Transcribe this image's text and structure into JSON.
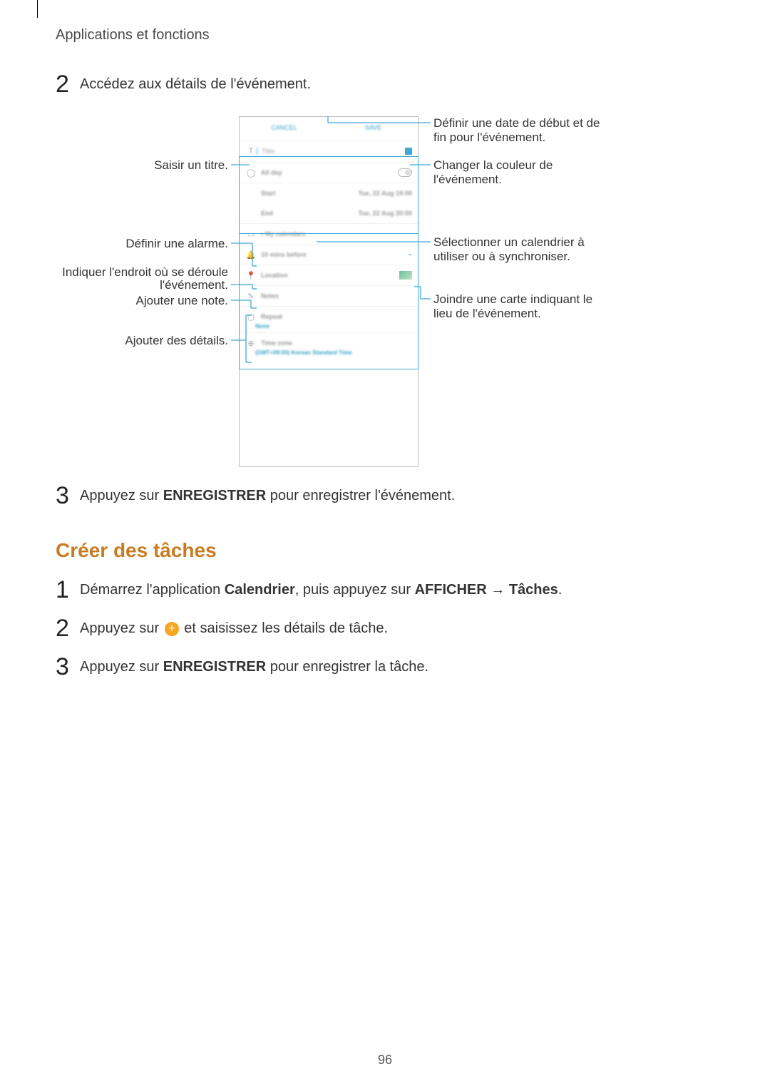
{
  "header": {
    "title": "Applications et fonctions"
  },
  "sec1": {
    "step2": {
      "num": "2",
      "text": "Accédez aux détails de l'événement."
    },
    "step3": {
      "num": "3",
      "prefix": "Appuyez sur ",
      "bold": "ENREGISTRER",
      "suffix": " pour enregistrer l'événement."
    }
  },
  "callouts": {
    "left": {
      "title": "Saisir un titre.",
      "alarm": "Définir une alarme.",
      "location_l1": "Indiquer l'endroit où se déroule",
      "location_l2": "l'événement.",
      "note": "Ajouter une note.",
      "details": "Ajouter des détails."
    },
    "right": {
      "dates_l1": "Définir une date de début et de",
      "dates_l2": "fin pour l'événement.",
      "color_l1": "Changer la couleur de",
      "color_l2": "l'événement.",
      "cal_l1": "Sélectionner un calendrier à",
      "cal_l2": "utiliser ou à synchroniser.",
      "map_l1": "Joindre une carte indiquant le",
      "map_l2": "lieu de l'événement."
    }
  },
  "mock": {
    "cancel": "CANCEL",
    "save": "SAVE",
    "title_ph": "Title",
    "allday": "All day",
    "start": "Start",
    "start_val": "Tue, 22 Aug   19:00",
    "end": "End",
    "end_val": "Tue, 22 Aug   20:00",
    "calendars": "• My calendars",
    "reminder": "10 mins before",
    "location": "Location",
    "notes": "Notes",
    "repeat": "Repeat",
    "repeat_sub": "None",
    "timezone": "Time zone",
    "timezone_sub": "(GMT+09:00) Korean Standard Time"
  },
  "sec2": {
    "heading": "Créer des tâches",
    "step1": {
      "num": "1",
      "prefix": "Démarrez l'application ",
      "b1": "Calendrier",
      "mid": ", puis appuyez sur ",
      "b2": "AFFICHER",
      "arrow": " → ",
      "b3": "Tâches",
      "suffix": "."
    },
    "step2": {
      "num": "2",
      "prefix": "Appuyez sur ",
      "suffix": " et saisissez les détails de tâche."
    },
    "step3": {
      "num": "3",
      "prefix": "Appuyez sur ",
      "bold": "ENREGISTRER",
      "suffix": " pour enregistrer la tâche."
    }
  },
  "page_number": "96"
}
